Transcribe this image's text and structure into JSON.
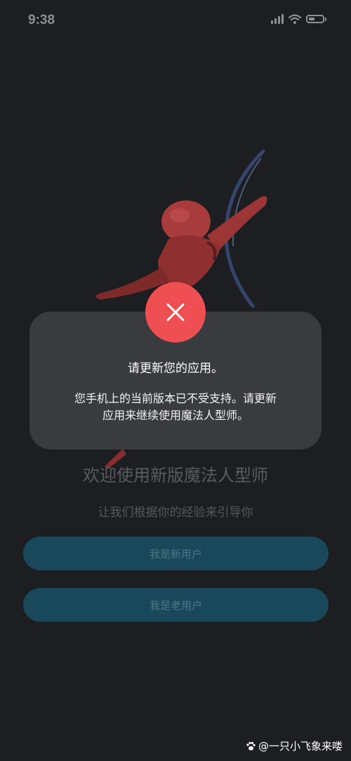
{
  "status_bar": {
    "time": "9:38",
    "battery_level": 0.3
  },
  "background": {
    "welcome_title": "欢迎使用新版魔法人型师",
    "welcome_subtitle": "让我们根据你的经验来引导你",
    "new_user_button": "我是新用户",
    "existing_user_button": "我是老用户"
  },
  "dialog": {
    "title": "请更新您的应用。",
    "message_line1": "您手机上的当前版本已不受支持。请更新",
    "message_line2": "应用来继续使用魔法人型师。",
    "icon": "close-icon",
    "accent_color": "#ef4f53"
  },
  "watermark": {
    "text": "@一只小飞象来喽"
  }
}
